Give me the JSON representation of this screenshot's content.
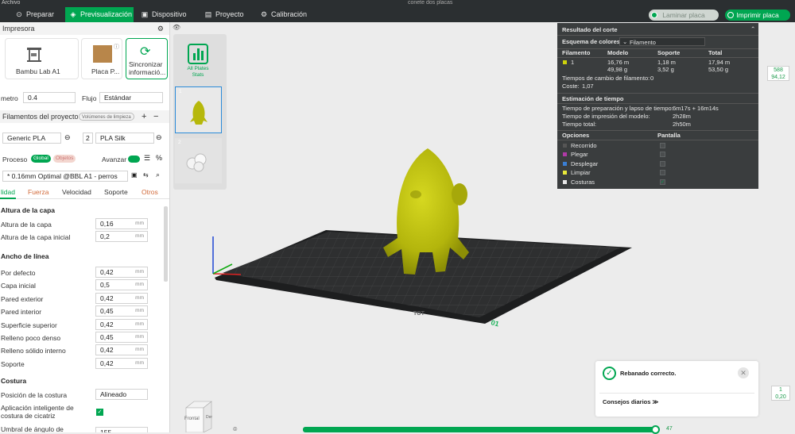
{
  "topbar": {
    "menu": "Archivo",
    "title": "conete dos placas"
  },
  "nav": {
    "tabs": [
      {
        "label": "Preparar",
        "icon": "prepare-icon"
      },
      {
        "label": "Previsualización",
        "icon": "preview-icon",
        "active": true
      },
      {
        "label": "Dispositivo",
        "icon": "device-icon"
      },
      {
        "label": "Proyecto",
        "icon": "project-icon"
      },
      {
        "label": "Calibración",
        "icon": "calibration-icon"
      }
    ],
    "slice_label": "Laminar placa",
    "print_label": "Imprimir placa"
  },
  "printer": {
    "section_title": "Impresora",
    "printer_name": "Bambu Lab A1",
    "plate_name": "Placa P...",
    "sync_line1": "Sincronizar",
    "sync_line2": "informació...",
    "diameter_label": "metro",
    "diameter_value": "0.4",
    "flow_label": "Flujo",
    "flow_value": "Estándar"
  },
  "filaments": {
    "section_title": "Filamentos del proyecto",
    "volumes_button": "Volúmenes de limpieza",
    "items": [
      {
        "index": "1",
        "name": "Generic PLA",
        "color": "#cdd20b"
      },
      {
        "index": "2",
        "name": "PLA Silk",
        "color": "#333333"
      }
    ]
  },
  "process": {
    "title": "Proceso",
    "toggle_global": "Global",
    "toggle_objects": "Objetos",
    "advanced_label": "Avanzar",
    "preset": "* 0.16mm Optimal @BBL A1 - perros",
    "tabs": [
      "lidad",
      "Fuerza",
      "Velocidad",
      "Soporte",
      "Otros"
    ]
  },
  "settings": {
    "layer_group": "Altura de la capa",
    "layer_height_label": "Altura de la capa",
    "layer_height_value": "0,16",
    "initial_layer_label": "Altura de la capa inicial",
    "initial_layer_value": "0,2",
    "width_group": "Ancho de línea",
    "width_items": [
      {
        "label": "Por defecto",
        "value": "0,42"
      },
      {
        "label": "Capa inicial",
        "value": "0,5"
      },
      {
        "label": "Pared exterior",
        "value": "0,42"
      },
      {
        "label": "Pared interior",
        "value": "0,45"
      },
      {
        "label": "Superficie superior",
        "value": "0,42"
      },
      {
        "label": "Relleno poco denso",
        "value": "0,45"
      },
      {
        "label": "Relleno sólido interno",
        "value": "0,42"
      },
      {
        "label": "Soporte",
        "value": "0,42"
      }
    ],
    "unit": "mm",
    "seam_group": "Costura",
    "seam_position_label": "Posición de la costura",
    "seam_position_value": "Alineado",
    "smart_seam_line1": "Aplicación inteligente de",
    "smart_seam_line2": "costura de cicatriz",
    "threshold_label": "Umbral de ángulo de",
    "threshold_value": "155"
  },
  "plates_panel": {
    "stats_line1": "All Plates",
    "stats_line2": "Stats",
    "plate1": "1",
    "plate2": "2"
  },
  "result": {
    "title": "Resultado del corte",
    "color_scheme_label": "Esquema de colores",
    "color_scheme_value": "Filamento",
    "headers": [
      "Filamento",
      "Modelo",
      "Soporte",
      "Total"
    ],
    "row": {
      "index": "1",
      "model_len": "16,76 m",
      "model_g": "49,98 g",
      "support_len": "1,18 m",
      "support_g": "3,52 g",
      "total_len": "17,94 m",
      "total_g": "53,50 g"
    },
    "changes_label": "Tiempos de cambio de filamento:",
    "changes_value": "0",
    "cost_label": "Coste:",
    "cost_value": "1,07",
    "time_title": "Estimación de tiempo",
    "prep_label": "Tiempo de preparación y lapso de tiempo:",
    "prep_value": "6m17s + 16m14s",
    "model_time_label": "Tiempo de impresión del modelo:",
    "model_time_value": "2h28m",
    "total_time_label": "Tiempo total:",
    "total_time_value": "2h50m",
    "options_header": "Opciones",
    "display_header": "Pantalla",
    "options": [
      {
        "label": "Recorrido",
        "color": "#555555"
      },
      {
        "label": "Plegar",
        "color": "#b03aa7"
      },
      {
        "label": "Desplegar",
        "color": "#3a7fd5"
      },
      {
        "label": "Limpiar",
        "color": "#e8e83a"
      },
      {
        "label": "Costuras",
        "color": "#e8e8e8"
      }
    ]
  },
  "side_numbers": {
    "top_a": "588",
    "top_b": "94,12",
    "bottom_a": "1",
    "bottom_b": "0,20",
    "slider_value": "47"
  },
  "notification": {
    "message": "Rebanado correcto.",
    "tips": "Consejos diarios"
  },
  "viewcube": {
    "front": "Frontal",
    "right": "Der"
  },
  "bed_label": "01"
}
